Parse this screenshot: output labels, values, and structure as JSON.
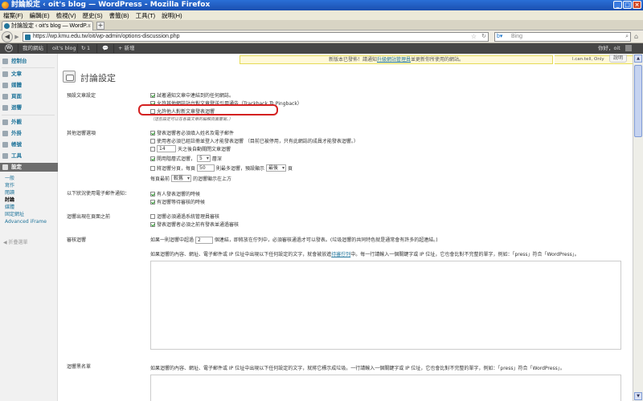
{
  "window": {
    "title": "討論設定 ‹ oit's blog — WordPress - Mozilla Firefox"
  },
  "menu": [
    "檔案(F)",
    "編輯(E)",
    "檢視(V)",
    "歷史(S)",
    "書籤(B)",
    "工具(T)",
    "說明(H)"
  ],
  "tab": {
    "title": "討論設定 ‹ oit's blog — WordP..."
  },
  "nav": {
    "url": "https://wp.kmu.edu.tw/oit/wp-admin/options-discussion.php",
    "search_placeholder": "Bing"
  },
  "adminbar": {
    "my_sites": "我的網站",
    "site_name": "oit's blog",
    "updates": "1",
    "comments": "",
    "new": "+ 新增",
    "howdy": "你好，oit"
  },
  "sidebar": {
    "items": [
      {
        "label": "控制台"
      },
      {
        "label": "文章"
      },
      {
        "label": "媒體"
      },
      {
        "label": "頁面"
      },
      {
        "label": "迴響"
      },
      {
        "label": "外觀"
      },
      {
        "label": "外掛"
      },
      {
        "label": "帳號"
      },
      {
        "label": "工具"
      },
      {
        "label": "設定"
      }
    ],
    "submenu": [
      "一般",
      "寫作",
      "閱讀",
      "討論",
      "媒體",
      "固定網址",
      "Advanced iFrame"
    ],
    "collapse": "折疊選單"
  },
  "notice": {
    "text_before": "新版本已發佈！請通知",
    "link": "升級網站管理員",
    "text_after": "並更新你所使用的網站。"
  },
  "user_label": "l.can.tell, Only",
  "screen_options": "說明",
  "page_title": "討論設定",
  "sections": {
    "default_settings": {
      "label": "預設文章設定",
      "opt1": "試著通知文章中連結到的任何網誌。",
      "opt2": "允許其他網誌站台對文章發送引用通告（Trackback 及 Pingback）",
      "opt3": "允許他人對新文章發表迴響",
      "note": "（這些設定可以在各篇文章的編輯頁面覆寫。）"
    },
    "other_comment": {
      "label": "其他迴響選項",
      "opt1": "發表迴響者必須填入姓名及電子郵件",
      "opt2": "使用者必須已經註冊並登入才能發表迴響 （目前已被停用，只有此網誌的成員才能發表迴響。）",
      "opt3_num": "14",
      "opt3": "天之後自動關閉文章迴響",
      "opt4_pre": "開用階層式迴響，",
      "opt4_num": "5",
      "opt4_post": "層深",
      "opt5_pre": "將迴響分頁，每頁",
      "opt5_num": "50",
      "opt5_mid": "則最多迴響，預設顯示",
      "opt5_sel": "最後",
      "opt5_post": "頁",
      "opt6_pre": "每頁最前",
      "opt6_sel": "較舊",
      "opt6_post": "的迴響顯示在上方"
    },
    "email_me": {
      "label": "以下狀況使用電子郵件通知：",
      "opt1": "有人發表迴響的時候",
      "opt2": "有迴響等待審核的時候"
    },
    "before_appear": {
      "label": "迴響出現在頁面之前",
      "opt1": "迴響必須通過系統管理員審核",
      "opt2": "發表迴響者必須之前有發表並通過審核"
    },
    "moderation": {
      "label": "審核迴響",
      "line1_pre": "如果一則迴響中超過",
      "line1_num": "2",
      "line1_post": "個連結，即將放在佇列中，必須審核通過才可以發表。(垃圾迴響的共同特色就是通常會有許多的超連結。)",
      "line2_pre": "如果迴響的內容、網址、電子郵件或 IP 位址中出現以下任何設定的文字，就會被放進",
      "line2_link": "待審佇列",
      "line2_post": "中。每一行請輸入一個關鍵字或 IP 位址，它也會比對不完整的單字，例如：「press」符合「WordPress」。"
    },
    "blacklist": {
      "label": "迴響黑名單",
      "line": "如果迴響的內容、網址、電子郵件或 IP 位址中出現以下任何設定的文字，就將它標示成垃圾。一行請輸入一個關鍵字或 IP 位址，它也會比對不完整的單字，例如：「press」符合「WordPress」。"
    }
  },
  "colors": {
    "link": "#21759b",
    "admin_bar": "#464646",
    "highlight": "#d42020",
    "notice_bg": "#fff9d8"
  }
}
